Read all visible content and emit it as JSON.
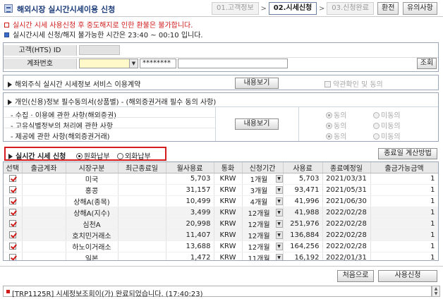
{
  "window": {
    "title": "해외시장 실시간시세이용 신청"
  },
  "steps": [
    {
      "label": "01.고객정보",
      "active": false
    },
    {
      "label": "02.시세신청",
      "active": true
    },
    {
      "label": "03.신청완료",
      "active": false
    }
  ],
  "header_buttons": {
    "close": "환전",
    "notes": "유의사항"
  },
  "notices": {
    "warning": "실시간 시세 사용신청 후 중도해지로 인한 환불은 불가합니다.",
    "info": "실시간시세 신청/해지 불가능한 시간은 23:40 ~ 00:10 입니다."
  },
  "customer": {
    "id_label": "고객(HTS) ID",
    "id_value": "",
    "account_label": "계좌번호",
    "account_value": "",
    "password_value": "********",
    "account_name_value": "",
    "query_button": "조회"
  },
  "agreement1": {
    "title": "해외주식 실시간 시세정보 서비스 이용계약",
    "view_button": "내용보기",
    "confirm_label": "약관확인 및 동의"
  },
  "agreement2": {
    "title": "개인(신용)정보 필수동의서(상품별) - (해외증권거래 필수 동의 사항)",
    "view_button": "내용보기",
    "agree_label": "동의",
    "disagree_label": "미동의",
    "items": [
      {
        "label": "- 수집 · 이용에 관한 사항(해외증권)"
      },
      {
        "label": "- 고유식별정보의 처리에 관한 사항"
      },
      {
        "label": "- 제공에 관한 사항(해외증권거래)"
      }
    ]
  },
  "realtime": {
    "title": "실시간 시세 신청",
    "option_won": "원화납부",
    "option_fx": "외화납부",
    "selected": "won",
    "calc_button": "종료일 계산방법"
  },
  "table": {
    "columns": [
      "선택",
      "출금계좌",
      "시장구분",
      "최근종료일",
      "월사용료",
      "통화",
      "신청기간",
      "사용료",
      "종료예정일",
      "출금가능금액"
    ],
    "rows": [
      {
        "checked": true,
        "account": "",
        "market": "미국",
        "last_end": "",
        "monthly_fee": "5,703",
        "currency": "KRW",
        "period": "1개월",
        "fee": "5,703",
        "end_date": "2021/03/31",
        "available": "1"
      },
      {
        "checked": true,
        "account": "",
        "market": "홍콩",
        "last_end": "",
        "monthly_fee": "31,157",
        "currency": "KRW",
        "period": "3개월",
        "fee": "93,471",
        "end_date": "2021/05/31",
        "available": "1"
      },
      {
        "checked": true,
        "account": "",
        "market": "상해A(종목)",
        "last_end": "",
        "monthly_fee": "10,499",
        "currency": "KRW",
        "period": "4개월",
        "fee": "41,996",
        "end_date": "2021/06/30",
        "available": "1"
      },
      {
        "checked": true,
        "account": "",
        "market": "상해A(지수)",
        "last_end": "",
        "monthly_fee": "3,499",
        "currency": "KRW",
        "period": "12개월",
        "fee": "41,988",
        "end_date": "2022/02/28",
        "available": "1"
      },
      {
        "checked": true,
        "account": "",
        "market": "심천A",
        "last_end": "",
        "monthly_fee": "20,998",
        "currency": "KRW",
        "period": "12개월",
        "fee": "251,976",
        "end_date": "2022/02/28",
        "available": "1"
      },
      {
        "checked": true,
        "account": "",
        "market": "호치민거래소",
        "last_end": "",
        "monthly_fee": "11,407",
        "currency": "KRW",
        "period": "12개월",
        "fee": "136,884",
        "end_date": "2022/02/28",
        "available": "1"
      },
      {
        "checked": true,
        "account": "",
        "market": "하노이거래소",
        "last_end": "",
        "monthly_fee": "13,688",
        "currency": "KRW",
        "period": "12개월",
        "fee": "164,256",
        "end_date": "2022/02/28",
        "available": "1"
      },
      {
        "checked": true,
        "account": "",
        "market": "일본",
        "last_end": "",
        "monthly_fee": "1,472",
        "currency": "KRW",
        "period": "11개월",
        "fee": "16,192",
        "end_date": "2022/01/31",
        "available": "1"
      }
    ]
  },
  "footer": {
    "reset_button": "처음으로",
    "apply_button": "사용신청"
  },
  "status": {
    "message": "[TRP1125R] 시세정보조회이(가) 완료되었습니다. (17:40:23)"
  },
  "colors": {
    "accent_red": "#d61d1d",
    "title_blue": "#1a3a78",
    "combo_yellow": "#fff8c8"
  }
}
